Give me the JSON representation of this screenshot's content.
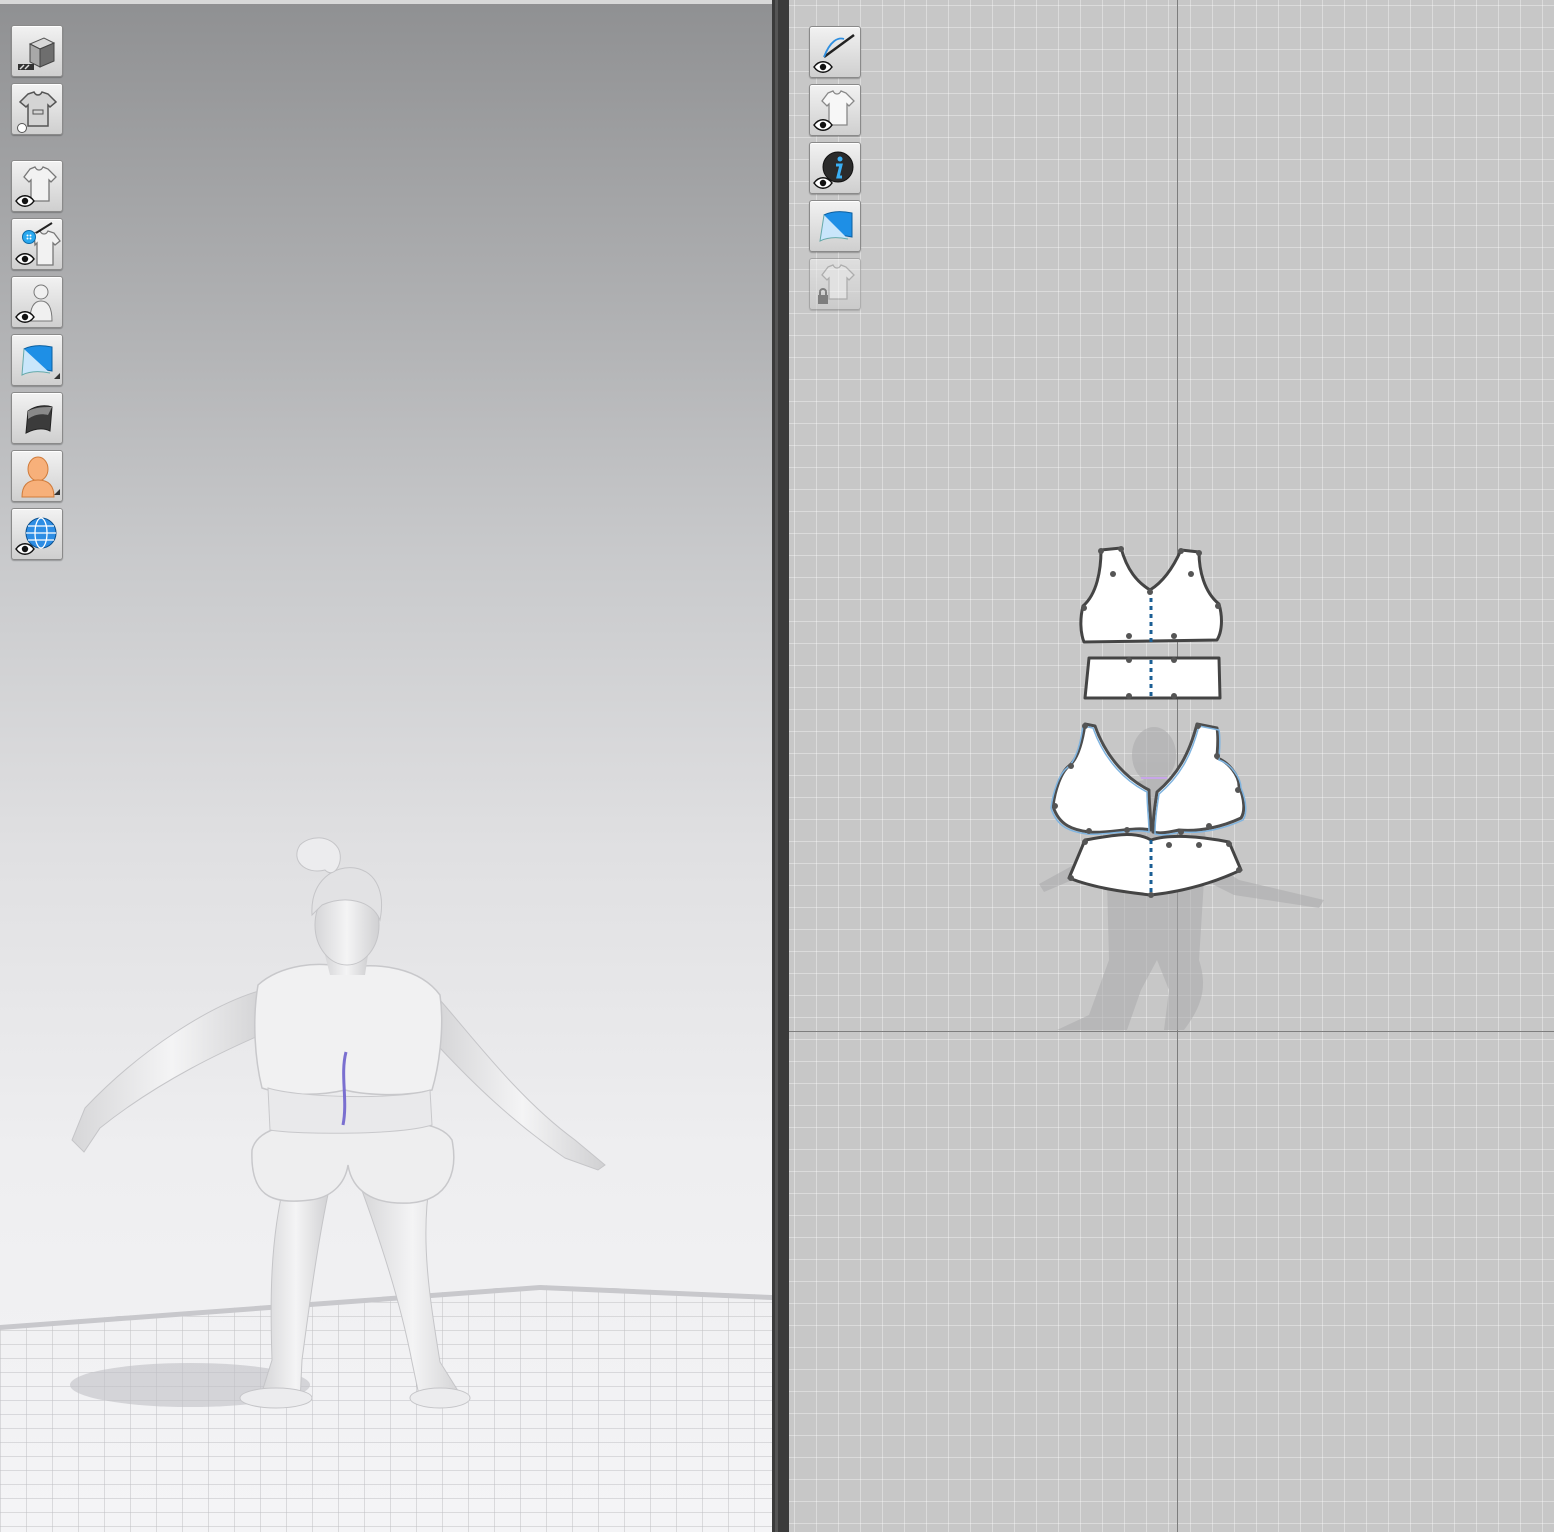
{
  "app": {
    "colors": {
      "accent_blue": "#2f8fe0",
      "seam_blue": "#3a6ea5",
      "pattern_fill": "#ffffff",
      "avatar_gray": "#e9e9ea"
    }
  },
  "viewport3d": {
    "toolbar": [
      {
        "name": "3d-view-mode-button",
        "icon": "cube-icon"
      },
      {
        "name": "garment-display-button",
        "icon": "tshirt-icon"
      },
      {
        "name": "show-garment-button",
        "icon": "eye-tshirt-icon"
      },
      {
        "name": "show-trims-button",
        "icon": "eye-button-tshirt-icon"
      },
      {
        "name": "show-avatar-button",
        "icon": "eye-avatar-icon"
      },
      {
        "name": "fabric-texture-button",
        "icon": "fabric-swatch-icon"
      },
      {
        "name": "surface-render-button",
        "icon": "surface-icon"
      },
      {
        "name": "avatar-appearance-button",
        "icon": "avatar-skin-icon"
      },
      {
        "name": "show-environment-button",
        "icon": "globe-icon"
      }
    ]
  },
  "viewport2d": {
    "toolbar": [
      {
        "name": "show-sewing-lines-button",
        "icon": "needle-eye-icon"
      },
      {
        "name": "show-pattern-pieces-button",
        "icon": "eye-tshirt-icon"
      },
      {
        "name": "show-piece-info-button",
        "icon": "info-icon"
      },
      {
        "name": "show-2d-texture-button",
        "icon": "fabric-swatch-icon"
      },
      {
        "name": "lock-garment-button",
        "icon": "lock-tshirt-icon",
        "disabled": true
      }
    ]
  }
}
